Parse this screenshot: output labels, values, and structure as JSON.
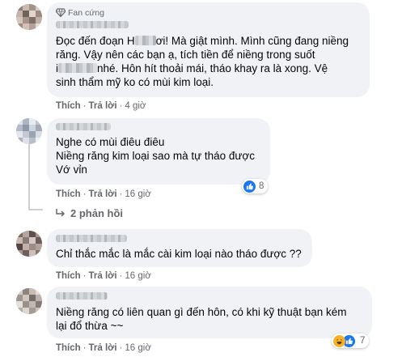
{
  "comments": [
    {
      "badge": "Fan cứng",
      "lines": [
        [
          "Đọc đến đoạn H",
          "ơi! Mà giật mình. Mình cũng đang niềng"
        ],
        [
          "răng. Vậy nên các bạn ạ, tích tiền để niềng trong suốt"
        ],
        [
          "i",
          "nhé. Hôn hít thoải mái, tháo khay ra là xong. Vệ"
        ],
        [
          "sinh thẩm mỹ ko có mùi kim loại."
        ]
      ],
      "like": "Thích",
      "reply": "Trả lời",
      "time": "4 giờ"
    },
    {
      "lines": [
        "Nghe có mùi điêu điêu",
        "Niềng răng kim loại sao mà tự tháo được",
        "Vớ vỉn"
      ],
      "like": "Thích",
      "reply": "Trả lời",
      "time": "16 giờ",
      "reaction_count": "8",
      "replies_label": "2 phản hồi"
    },
    {
      "lines": [
        "Chỉ thắc mắc là mắc cài kim loại nào tháo được ??"
      ],
      "like": "Thích",
      "reply": "Trả lời",
      "time": "16 giờ"
    },
    {
      "lines": [
        "Niềng răng có liên quan gì đến hôn, có khi kỹ thuật bạn kém",
        "lại đổ thừa ~~"
      ],
      "like": "Thích",
      "reply": "Trả lời",
      "time": "16 giờ",
      "reaction_count": "7"
    }
  ],
  "colors": {
    "bubble": "#f0f2f5",
    "meta_text": "#65676b",
    "like_blue": "#1877f2",
    "haha_yellow": "#f7b125"
  },
  "icons": [
    "fan-badge-icon",
    "like-reaction-icon",
    "haha-reaction-icon",
    "reply-arrow-icon"
  ]
}
